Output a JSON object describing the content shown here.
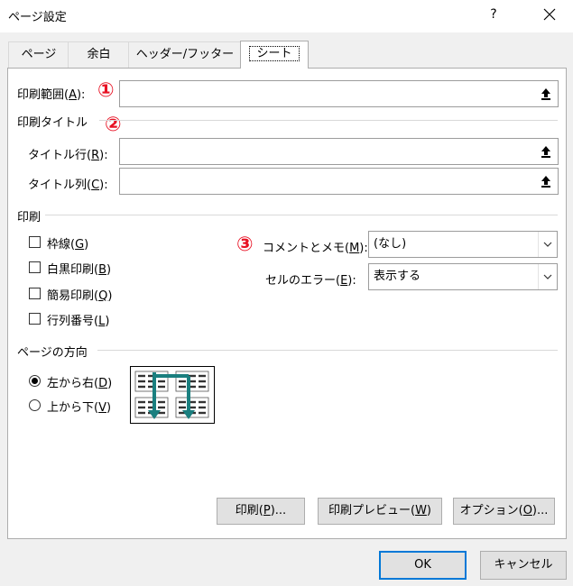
{
  "window": {
    "title": "ページ設定",
    "help_label": "?"
  },
  "tabs": [
    {
      "label": "ページ"
    },
    {
      "label": "余白"
    },
    {
      "label": "ヘッダー/フッター"
    },
    {
      "label": "シート"
    }
  ],
  "sheet": {
    "print_area": {
      "label_pre": "印刷範囲(",
      "key": "A",
      "label_post": "):",
      "value": ""
    },
    "print_titles": {
      "heading": "印刷タイトル",
      "rows": {
        "label_pre": "タイトル行(",
        "key": "R",
        "label_post": "):",
        "value": ""
      },
      "cols": {
        "label_pre": "タイトル列(",
        "key": "C",
        "label_post": "):",
        "value": ""
      }
    },
    "print": {
      "heading": "印刷",
      "gridlines": {
        "label_pre": "枠線(",
        "key": "G",
        "label_post": ")",
        "checked": false
      },
      "black_white": {
        "label_pre": "白黒印刷(",
        "key": "B",
        "label_post": ")",
        "checked": false
      },
      "draft": {
        "label_pre": "簡易印刷(",
        "key": "Q",
        "label_post": ")",
        "checked": false
      },
      "headings": {
        "label_pre": "行列番号(",
        "key": "L",
        "label_post": ")",
        "checked": false
      },
      "comments": {
        "label_pre": "コメントとメモ(",
        "key": "M",
        "label_post": "):",
        "value": "(なし)"
      },
      "errors": {
        "label_pre": "セルのエラー(",
        "key": "E",
        "label_post": "):",
        "value": "表示する"
      }
    },
    "page_order": {
      "heading": "ページの方向",
      "down_then_over": {
        "label_pre": "左から右(",
        "key": "D",
        "label_post": ")",
        "selected": true
      },
      "over_then_down": {
        "label_pre": "上から下(",
        "key": "V",
        "label_post": ")",
        "selected": false
      }
    },
    "buttons": {
      "print": {
        "pre": "印刷(",
        "key": "P",
        "post": ")..."
      },
      "preview": {
        "pre": "印刷プレビュー(",
        "key": "W",
        "post": ")"
      },
      "options": {
        "pre": "オプション(",
        "key": "O",
        "post": ")..."
      }
    }
  },
  "annotations": [
    "①",
    "②",
    "③"
  ],
  "footer": {
    "ok": "OK",
    "cancel": "キャンセル"
  },
  "colors": {
    "annotation": "#e81123",
    "accent": "#0078d7",
    "arrow": "#1a7f7f"
  }
}
